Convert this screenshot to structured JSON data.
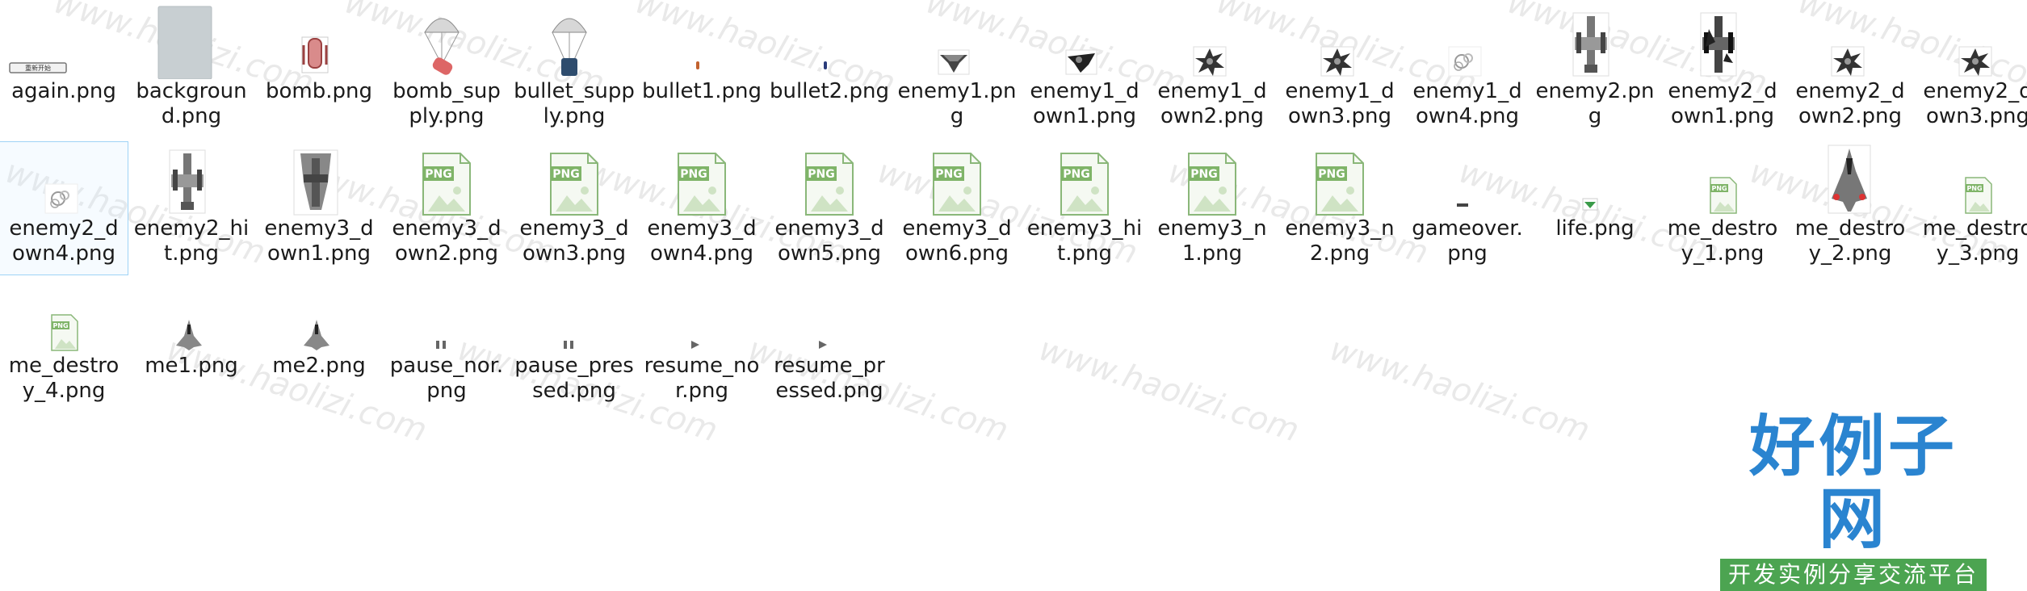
{
  "watermark_text": "www.haolizi.com",
  "files": [
    {
      "name": "again.png",
      "icon": "again-button-image",
      "art_text": "重新开始"
    },
    {
      "name": "background.png",
      "icon": "background-image"
    },
    {
      "name": "bomb.png",
      "icon": "bomb-image"
    },
    {
      "name": "bomb_supply.png",
      "icon": "parachute-bomb-image"
    },
    {
      "name": "bullet_supply.png",
      "icon": "parachute-bullet-image"
    },
    {
      "name": "bullet1.png",
      "icon": "bullet-red-image"
    },
    {
      "name": "bullet2.png",
      "icon": "bullet-blue-image"
    },
    {
      "name": "enemy1.png",
      "icon": "small-plane-image"
    },
    {
      "name": "enemy1_down1.png",
      "icon": "small-plane-down-image"
    },
    {
      "name": "enemy1_down2.png",
      "icon": "explosion-image"
    },
    {
      "name": "enemy1_down3.png",
      "icon": "explosion-image"
    },
    {
      "name": "enemy1_down4.png",
      "icon": "smoke-image"
    },
    {
      "name": "enemy2.png",
      "icon": "mid-plane-image"
    },
    {
      "name": "enemy2_down1.png",
      "icon": "mid-plane-down-image"
    },
    {
      "name": "enemy2_down2.png",
      "icon": "explosion-image"
    },
    {
      "name": "enemy2_down3.png",
      "icon": "explosion-image"
    },
    {
      "name": "enemy2_down4.png",
      "icon": "smoke-image"
    },
    {
      "name": "enemy2_hit.png",
      "icon": "mid-plane-image"
    },
    {
      "name": "enemy3_down1.png",
      "icon": "big-plane-image"
    },
    {
      "name": "enemy3_down2.png",
      "icon": "png-file-icon"
    },
    {
      "name": "enemy3_down3.png",
      "icon": "png-file-icon"
    },
    {
      "name": "enemy3_down4.png",
      "icon": "png-file-icon"
    },
    {
      "name": "enemy3_down5.png",
      "icon": "png-file-icon"
    },
    {
      "name": "enemy3_down6.png",
      "icon": "png-file-icon"
    },
    {
      "name": "enemy3_hit.png",
      "icon": "png-file-icon"
    },
    {
      "name": "enemy3_n1.png",
      "icon": "png-file-icon"
    },
    {
      "name": "enemy3_n2.png",
      "icon": "png-file-icon"
    },
    {
      "name": "gameover.png",
      "icon": "tiny-image"
    },
    {
      "name": "life.png",
      "icon": "tiny-plane-image"
    },
    {
      "name": "me_destroy_1.png",
      "icon": "png-file-icon-small"
    },
    {
      "name": "me_destroy_2.png",
      "icon": "player-plane-image"
    },
    {
      "name": "me_destroy_3.png",
      "icon": "png-file-icon-small"
    },
    {
      "name": "me_destroy_4.png",
      "icon": "png-file-icon-small"
    },
    {
      "name": "me1.png",
      "icon": "player-plane-image-small"
    },
    {
      "name": "me2.png",
      "icon": "player-plane-image-small"
    },
    {
      "name": "pause_nor.png",
      "icon": "pause-image"
    },
    {
      "name": "pause_pressed.png",
      "icon": "pause-image"
    },
    {
      "name": "resume_nor.png",
      "icon": "play-image"
    },
    {
      "name": "resume_pressed.png",
      "icon": "play-image"
    }
  ],
  "selected_file": "enemy2_down4.png",
  "brand": {
    "title": "好例子网",
    "subtitle": "开发实例分享交流平台"
  }
}
